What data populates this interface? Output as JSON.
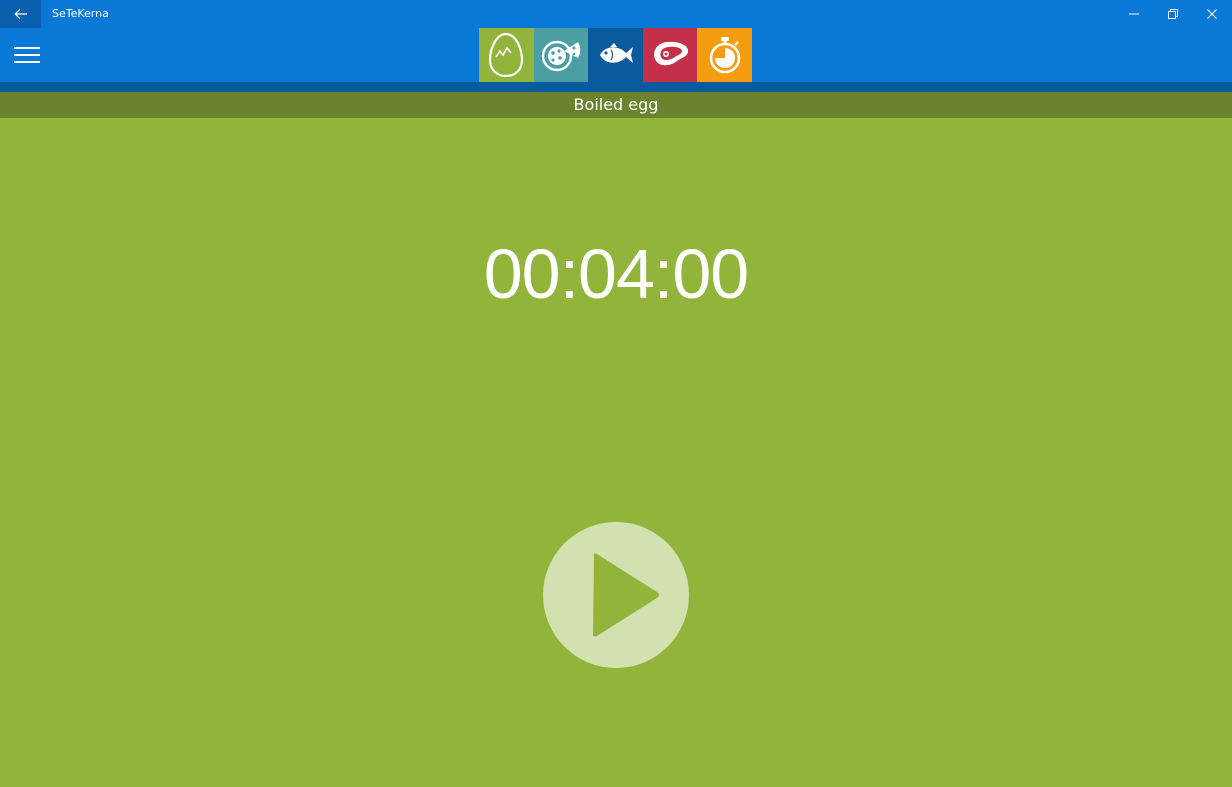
{
  "window": {
    "title": "SeTeKerna"
  },
  "categories": [
    {
      "name": "egg",
      "icon": "egg-icon",
      "color": "#92b43b"
    },
    {
      "name": "pizza",
      "icon": "pizza-icon",
      "color": "#4b9ea4"
    },
    {
      "name": "fish",
      "icon": "fish-icon",
      "color": "#0a5a9e"
    },
    {
      "name": "meat",
      "icon": "meat-icon",
      "color": "#c4304a"
    },
    {
      "name": "timer",
      "icon": "stopwatch-icon",
      "color": "#f59d0f"
    }
  ],
  "main": {
    "subtitle": "Boiled egg",
    "timer": "00:04:00"
  },
  "colors": {
    "titlebar": "#0a78d7",
    "back_button": "#0a5fae",
    "header_strip": "#0a5a9e",
    "subtitle_bar": "#6c832e",
    "background": "#92b43b",
    "play_button": "#d3e1b1"
  }
}
